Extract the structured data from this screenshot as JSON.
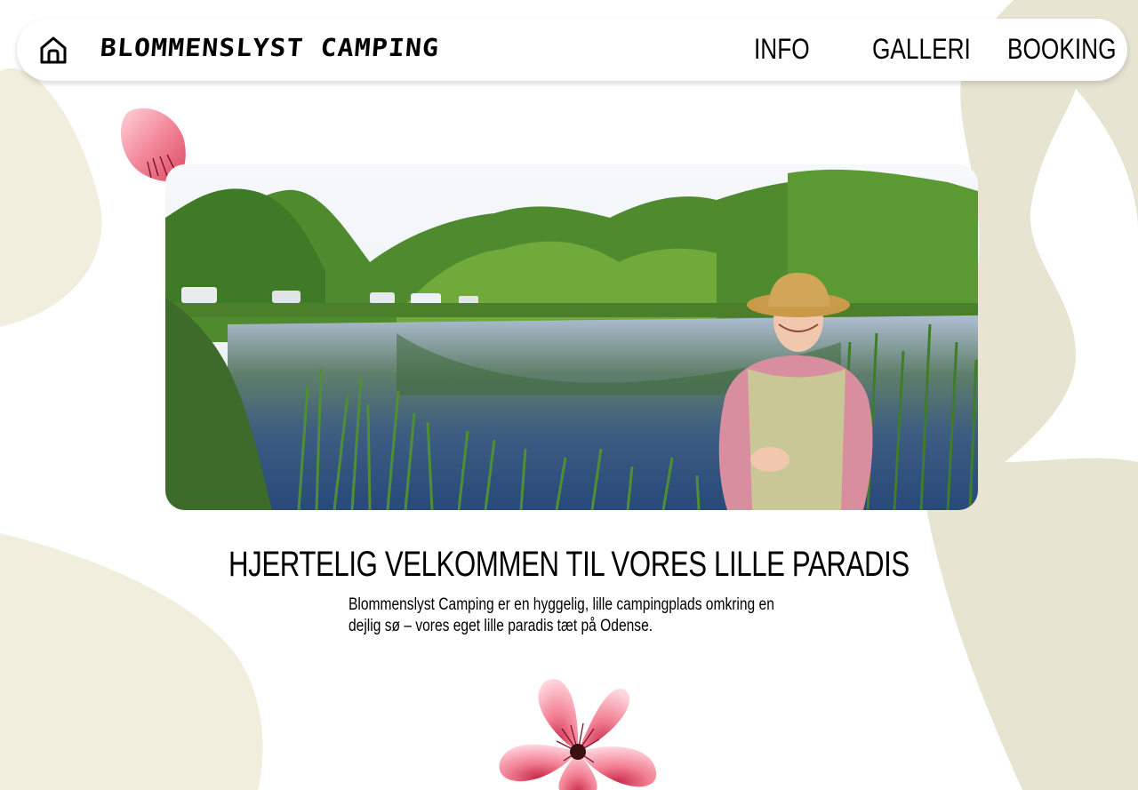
{
  "header": {
    "home_icon": "home-icon",
    "brand": "BLOMMENSLYST CAMPING",
    "nav": [
      {
        "label": "INFO"
      },
      {
        "label": "GALLERI"
      },
      {
        "label": "BOOKING"
      }
    ]
  },
  "main": {
    "hero_image": "Campsite by a lake with caravans, trees reflected in the water and a smiling woman in a straw hat",
    "heading": "HJERTELIG VELKOMMEN TIL VORES LILLE PARADIS",
    "intro_line1": "Blommenslyst Camping er en hyggelig, lille campingplads omkring en",
    "intro_line2": "dejlig sø – vores eget lille paradis tæt på Odense."
  },
  "colors": {
    "blob": "#f1eedd",
    "blob_right": "#e8e4d2",
    "flower_pink": "#f07a8e",
    "text": "#000000"
  }
}
